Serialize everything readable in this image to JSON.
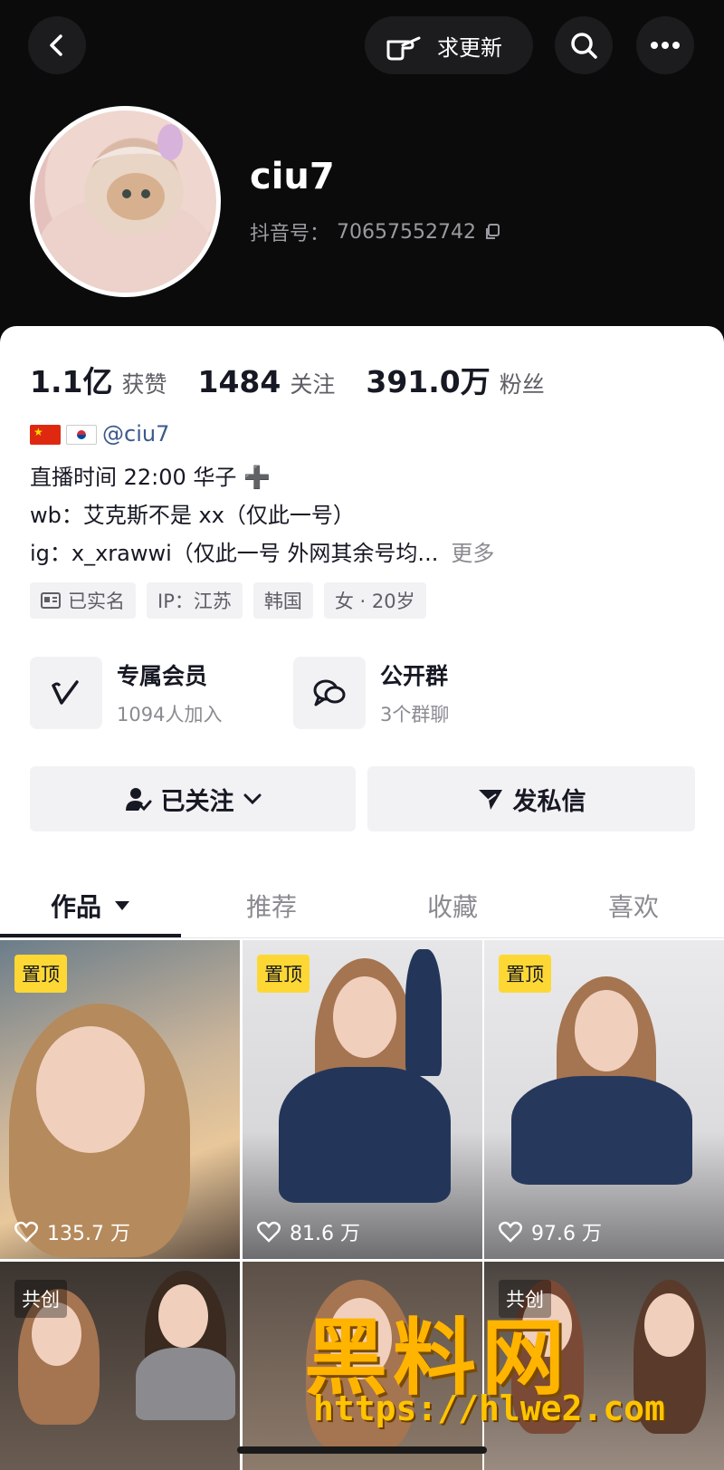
{
  "header": {
    "request_update_label": "求更新",
    "username": "ciu7",
    "douyin_id_label": "抖音号：",
    "douyin_id": "70657552742"
  },
  "stats": [
    {
      "value": "1.1亿",
      "label": "获赞"
    },
    {
      "value": "1484",
      "label": "关注"
    },
    {
      "value": "391.0万",
      "label": "粉丝"
    }
  ],
  "bio": {
    "mention": "@ciu7",
    "line2": "直播时间 22:00 华子 ➕",
    "line3": "wb：艾克斯不是 xx（仅此一号）",
    "line4": "ig：x_xrawwi（仅此一号 外网其余号均...",
    "more": "更多"
  },
  "tags": [
    "已实名",
    "IP：江苏",
    "韩国",
    "女 · 20岁"
  ],
  "features": [
    {
      "title": "专属会员",
      "sub": "1094人加入",
      "icon": "v-membership-icon"
    },
    {
      "title": "公开群",
      "sub": "3个群聊",
      "icon": "chat-group-icon"
    }
  ],
  "actions": {
    "followed": "已关注",
    "message": "发私信"
  },
  "tabs": [
    "作品",
    "推荐",
    "收藏",
    "喜欢"
  ],
  "videos": [
    {
      "badge": "置顶",
      "likes": "135.7 万"
    },
    {
      "badge": "置顶",
      "likes": "81.6 万"
    },
    {
      "badge": "置顶",
      "likes": "97.6 万"
    },
    {
      "badge": "共创",
      "likes": ""
    },
    {
      "badge": "",
      "likes": ""
    },
    {
      "badge": "共创",
      "likes": ""
    }
  ],
  "watermark": {
    "logo_text": "黑料网",
    "url": "https://hlwe2.com"
  },
  "colors": {
    "header_bg": "#0b0b0c",
    "pin_badge": "#fdd835",
    "watermark": "#ffb400"
  }
}
